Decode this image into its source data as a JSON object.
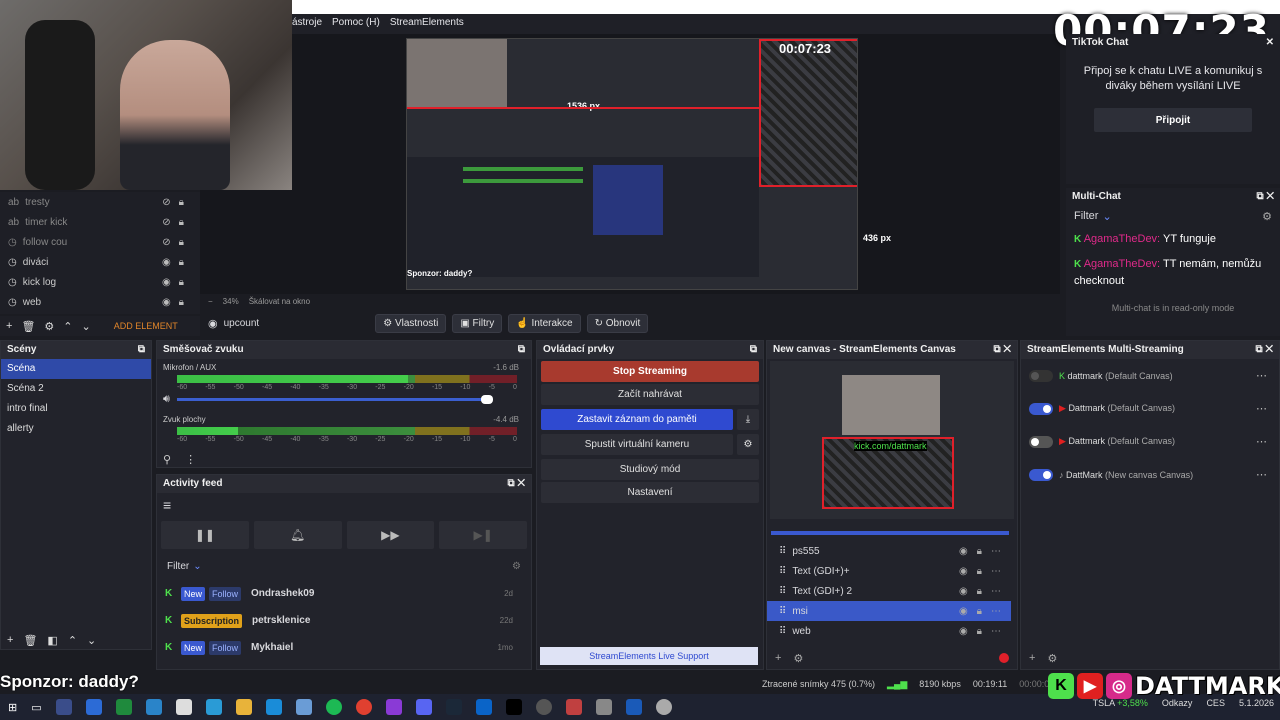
{
  "clock": "00:07:23",
  "menu": [
    "ástroje",
    "Pomoc (H)",
    "StreamElements"
  ],
  "sources": [
    {
      "label": "tresty",
      "hidden": true
    },
    {
      "label": "timer kick",
      "hidden": true
    },
    {
      "label": "follow cou",
      "hidden": true
    },
    {
      "label": "diváci",
      "hidden": false
    },
    {
      "label": "kick log",
      "hidden": false
    },
    {
      "label": "web",
      "hidden": false
    }
  ],
  "source_toolbar": {
    "add_element": "ADD ELEMENT"
  },
  "zoom": {
    "percent": "34%",
    "mode": "Škálovat na okno"
  },
  "preview_labels": {
    "width_px": "1536 px",
    "height_px": "436 px",
    "sponsor_inner": "Sponzor: daddy?",
    "timer_inner": "00:07:23"
  },
  "context_bar": {
    "name": "upcount",
    "properties": "Vlastnosti",
    "filters": "Filtry",
    "interaction": "Interakce",
    "refresh": "Obnovit"
  },
  "scenes": {
    "title": "Scény",
    "items": [
      {
        "label": "Scéna",
        "selected": true
      },
      {
        "label": "Scéna 2",
        "selected": false
      },
      {
        "label": "intro final",
        "selected": false
      },
      {
        "label": "allerty",
        "selected": false
      }
    ]
  },
  "mixer": {
    "title": "Směšovač zvuku",
    "channels": [
      {
        "name": "Mikrofon / AUX",
        "db": "-1.6 dB",
        "level": 0.68
      },
      {
        "name": "Zvuk plochy",
        "db": "-4.4 dB",
        "level": 0.18
      }
    ],
    "scale": [
      "-60",
      "-55",
      "-50",
      "-45",
      "-40",
      "-35",
      "-30",
      "-25",
      "-20",
      "-15",
      "-10",
      "-5",
      "0"
    ]
  },
  "activity": {
    "title": "Activity feed",
    "filter": "Filter",
    "rows": [
      {
        "badge1": "New",
        "badge2": "Follow",
        "user": "Ondrashek09",
        "time": "2d"
      },
      {
        "badge1": "Subscription",
        "badge2": "",
        "user": "petrsklenice",
        "time": "22d"
      },
      {
        "badge1": "New",
        "badge2": "Follow",
        "user": "Mykhaiel",
        "time": "1mo"
      }
    ]
  },
  "controls": {
    "title": "Ovládací prvky",
    "stop_streaming": "Stop Streaming",
    "record": "Začít nahrávat",
    "replay": "Zastavit záznam do paměti",
    "virtual_cam": "Spustit virtuální kameru",
    "studio": "Studiový mód",
    "settings": "Nastavení",
    "support": "StreamElements Live Support"
  },
  "canvas": {
    "title": "New canvas - StreamElements Canvas",
    "overlay_text": "kick.com/dattmark",
    "sources": [
      {
        "label": "ps555",
        "selected": false
      },
      {
        "label": "Text (GDI+)+",
        "selected": false
      },
      {
        "label": "Text (GDI+) 2",
        "selected": false
      },
      {
        "label": "msi",
        "selected": true
      },
      {
        "label": "web",
        "selected": false
      }
    ]
  },
  "multistream": {
    "title": "StreamElements Multi-Streaming",
    "rows": [
      {
        "name": "dattmark",
        "canvas": "(Default Canvas)",
        "state": "disabled",
        "platform": "kick"
      },
      {
        "name": "Dattmark",
        "canvas": "(Default Canvas)",
        "state": "on",
        "platform": "youtube"
      },
      {
        "name": "Dattmark",
        "canvas": "(Default Canvas)",
        "state": "off",
        "platform": "youtube"
      },
      {
        "name": "DattMark",
        "canvas": "(New canvas Canvas)",
        "state": "on",
        "platform": "tiktok"
      }
    ]
  },
  "tiktok_chat": {
    "title": "TikTok Chat",
    "text": "Připoj se k chatu LIVE a komunikuj s diváky během vysílání LIVE",
    "button": "Připojit"
  },
  "multi_chat": {
    "title": "Multi-Chat",
    "filter": "Filter",
    "messages": [
      {
        "user": "AgamaTheDev:",
        "text": " YT funguje"
      },
      {
        "user": "AgamaTheDev:",
        "text": " TT nemám, nemůžu checknout"
      }
    ],
    "readonly": "Multi-chat is in read-only mode"
  },
  "status": {
    "dropped": "Ztracené snímky 475 (0.7%)",
    "bitrate": "8190 kbps",
    "time1": "00:19:11",
    "time2": "00:00:0"
  },
  "overlay": {
    "sponsor": "Sponzor: daddy?",
    "brand": "DATTMARK"
  },
  "tray": {
    "stock": "TSLA",
    "change": "+3,58%",
    "links": "Odkazy",
    "lang": "CES",
    "date": "5.1.2026"
  },
  "colors": {
    "accent": "#2f4ad0",
    "stop": "#a83a2e",
    "kick": "#4ee04c",
    "chat_user": "#e02a8a"
  }
}
